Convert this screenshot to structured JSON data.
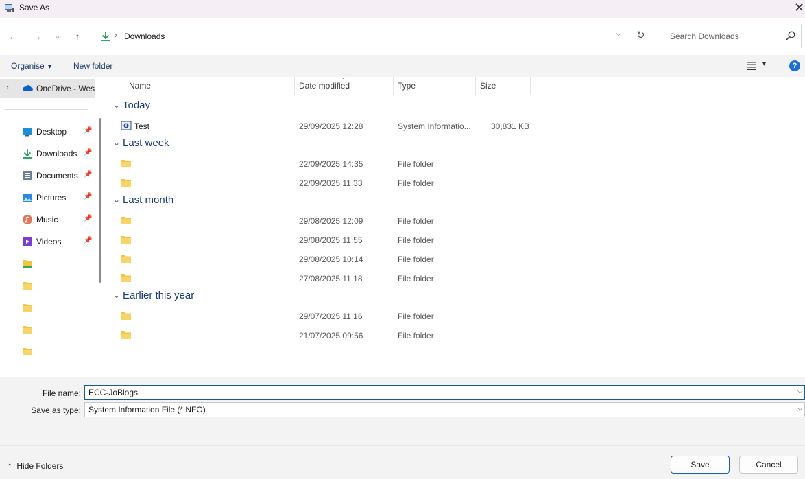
{
  "window": {
    "title": "Save As"
  },
  "address": {
    "crumb": "Downloads",
    "separator": "›"
  },
  "search": {
    "placeholder": "Search Downloads"
  },
  "toolbar": {
    "organise": "Organise",
    "organise_caret": "▾",
    "new_folder": "New folder",
    "help": "?"
  },
  "sidebar": {
    "top_item": "OneDrive - West",
    "quick_access": [
      {
        "label": "Desktop",
        "icon": "desktop-icon"
      },
      {
        "label": "Downloads",
        "icon": "download-icon"
      },
      {
        "label": "Documents",
        "icon": "documents-icon"
      },
      {
        "label": "Pictures",
        "icon": "pictures-icon"
      },
      {
        "label": "Music",
        "icon": "music-icon"
      },
      {
        "label": "Videos",
        "icon": "videos-icon"
      }
    ],
    "folder_count": 5
  },
  "columns": {
    "name": "Name",
    "date": "Date modified",
    "type": "Type",
    "size": "Size"
  },
  "groups": [
    {
      "label": "Today",
      "rows": [
        {
          "name": "Test",
          "date": "29/09/2025 12:28",
          "type": "System Informatio...",
          "size": "30,831 KB",
          "icon": "nfo-file-icon"
        }
      ]
    },
    {
      "label": "Last week",
      "rows": [
        {
          "name": "",
          "date": "22/09/2025 14:35",
          "type": "File folder",
          "size": "",
          "icon": "folder-icon"
        },
        {
          "name": "",
          "date": "22/09/2025 11:33",
          "type": "File folder",
          "size": "",
          "icon": "folder-icon"
        }
      ]
    },
    {
      "label": "Last month",
      "rows": [
        {
          "name": "",
          "date": "29/08/2025 12:09",
          "type": "File folder",
          "size": "",
          "icon": "folder-icon"
        },
        {
          "name": "",
          "date": "29/08/2025 11:55",
          "type": "File folder",
          "size": "",
          "icon": "folder-icon"
        },
        {
          "name": "",
          "date": "29/08/2025 10:14",
          "type": "File folder",
          "size": "",
          "icon": "folder-icon"
        },
        {
          "name": "",
          "date": "27/08/2025 11:18",
          "type": "File folder",
          "size": "",
          "icon": "folder-icon"
        }
      ]
    },
    {
      "label": "Earlier this year",
      "rows": [
        {
          "name": "",
          "date": "29/07/2025 11:16",
          "type": "File folder",
          "size": "",
          "icon": "folder-icon"
        },
        {
          "name": "",
          "date": "21/07/2025 09:56",
          "type": "File folder",
          "size": "",
          "icon": "folder-icon"
        }
      ]
    }
  ],
  "form": {
    "file_name_label": "File name:",
    "file_name_value": "ECC-JoBlogs",
    "save_type_label": "Save as type:",
    "save_type_value": "System Information File (*.NFO)"
  },
  "footer": {
    "hide_folders": "Hide Folders",
    "save": "Save",
    "cancel": "Cancel"
  },
  "colors": {
    "accent": "#1a6fd1",
    "folder": "#f4c542",
    "group_header": "#1b3a78"
  }
}
